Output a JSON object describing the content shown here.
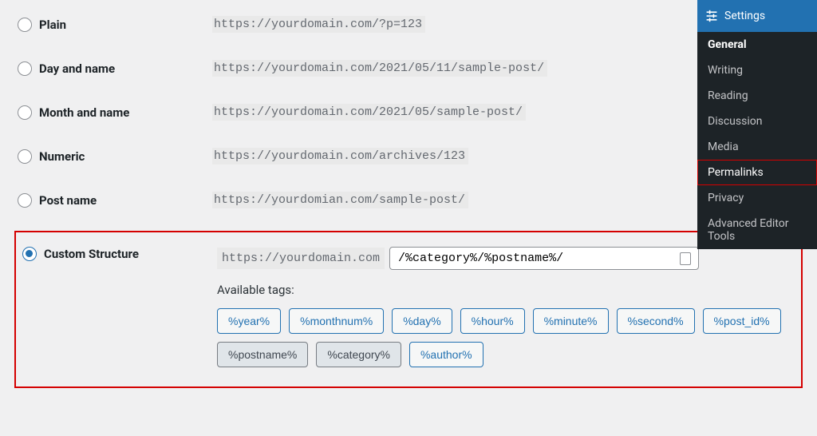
{
  "options": [
    {
      "key": "plain",
      "label": "Plain",
      "example": "https://yourdomain.com/?p=123"
    },
    {
      "key": "day-name",
      "label": "Day and name",
      "example": "https://yourdomain.com/2021/05/11/sample-post/"
    },
    {
      "key": "month-name",
      "label": "Month and name",
      "example": "https://yourdomain.com/2021/05/sample-post/"
    },
    {
      "key": "numeric",
      "label": "Numeric",
      "example": "https://yourdomain.com/archives/123"
    },
    {
      "key": "post-name",
      "label": "Post name",
      "example": "https://yourdomian.com/sample-post/"
    }
  ],
  "custom": {
    "label": "Custom Structure",
    "base_url": "https://yourdomain.com",
    "value": "/%category%/%postname%/",
    "available_label": "Available tags:",
    "tags_row1": [
      "%year%",
      "%monthnum%",
      "%day%",
      "%hour%",
      "%minute%",
      "%second%",
      "%post_id%"
    ],
    "tags_row2": [
      "%postname%",
      "%category%",
      "%author%"
    ],
    "active_tags": [
      "%postname%",
      "%category%"
    ]
  },
  "sidebar": {
    "header": "Settings",
    "items": [
      {
        "label": "General",
        "bold": true
      },
      {
        "label": "Writing"
      },
      {
        "label": "Reading"
      },
      {
        "label": "Discussion"
      },
      {
        "label": "Media"
      },
      {
        "label": "Permalinks",
        "highlighted": true
      },
      {
        "label": "Privacy"
      },
      {
        "label": "Advanced Editor Tools"
      }
    ]
  }
}
